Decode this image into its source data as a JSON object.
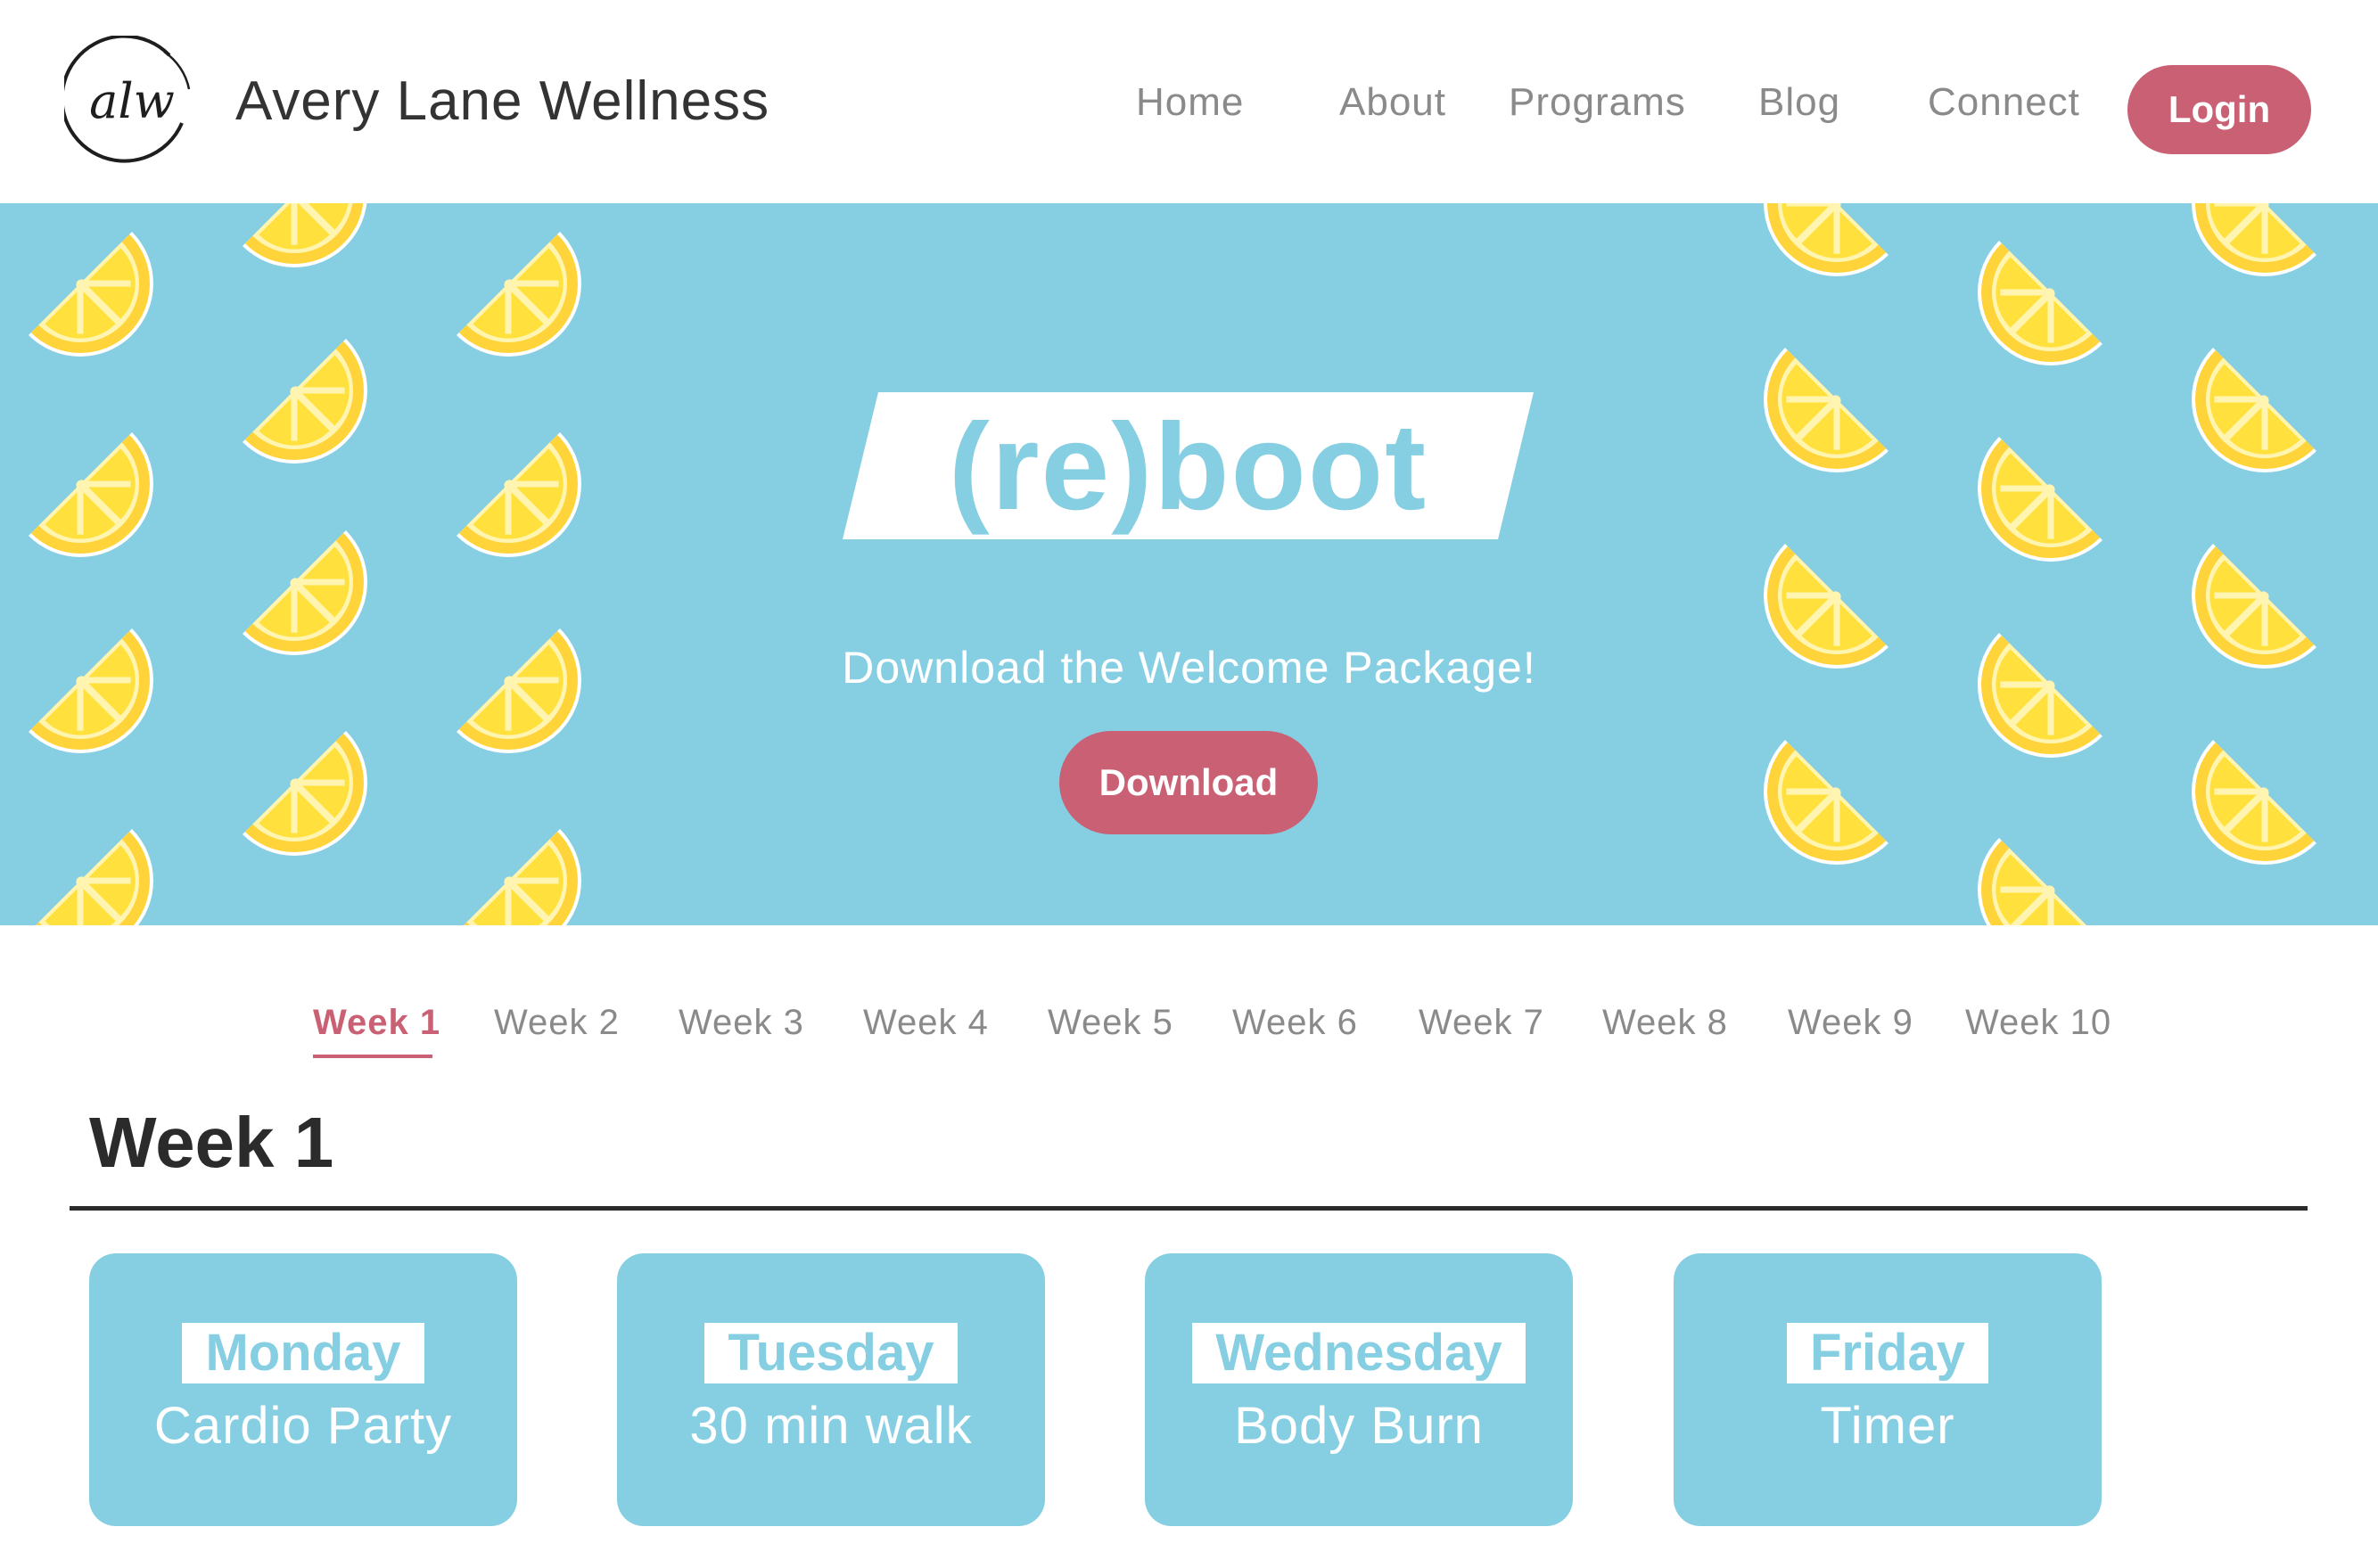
{
  "header": {
    "logo_text": "alw",
    "brand_name": "Avery Lane Wellness",
    "nav": [
      "Home",
      "About",
      "Programs",
      "Blog",
      "Connect"
    ],
    "login_label": "Login"
  },
  "hero": {
    "title": "(re)boot",
    "subtitle": "Download the Welcome Package!",
    "download_label": "Download"
  },
  "weeks": {
    "tabs": [
      "Week 1",
      "Week 2",
      "Week 3",
      "Week 4",
      "Week 5",
      "Week 6",
      "Week 7",
      "Week 8",
      "Week 9",
      "Week 10"
    ],
    "active_index": 0,
    "heading": "Week 1"
  },
  "days": [
    {
      "day": "Monday",
      "workout": "Cardio Party"
    },
    {
      "day": "Tuesday",
      "workout": "30 min walk"
    },
    {
      "day": "Wednesday",
      "workout": "Body Burn"
    },
    {
      "day": "Friday",
      "workout": "Timer"
    }
  ],
  "colors": {
    "accent": "#c96074",
    "hero_bg": "#86cfe3",
    "lemon": "#ffe03d",
    "lemon_rind": "#ffd43a"
  },
  "icons": {
    "logo": "alw-monogram-logo",
    "decoration": "lemon-slice-icon"
  }
}
